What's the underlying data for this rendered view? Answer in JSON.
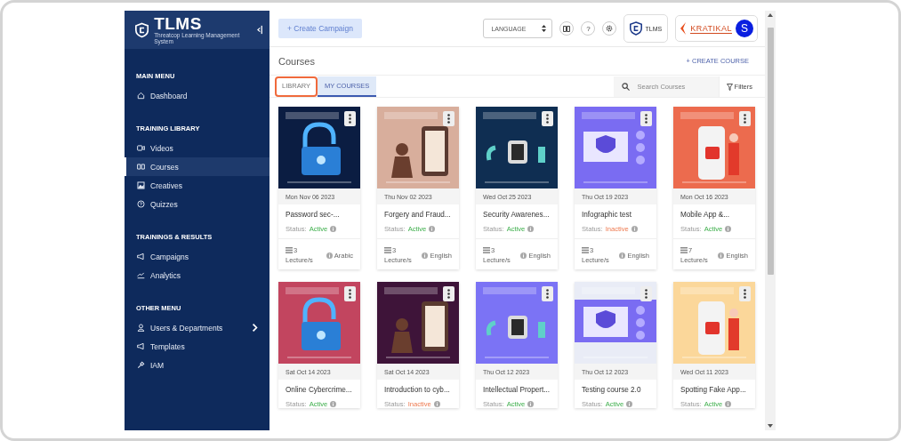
{
  "sidebar": {
    "logo_text": "TLMS",
    "logo_subtitle": "Threatcop Learning Management System",
    "sections": [
      {
        "title": "MAIN MENU",
        "items": [
          {
            "label": "Dashboard",
            "selected": false
          }
        ]
      },
      {
        "title": "TRAINING LIBRARY",
        "items": [
          {
            "label": "Videos",
            "selected": false
          },
          {
            "label": "Courses",
            "selected": true
          },
          {
            "label": "Creatives",
            "selected": false
          },
          {
            "label": "Quizzes",
            "selected": false
          }
        ]
      },
      {
        "title": "TRAININGS & RESULTS",
        "items": [
          {
            "label": "Campaigns",
            "selected": false
          },
          {
            "label": "Analytics",
            "selected": false
          }
        ]
      },
      {
        "title": "OTHER MENU",
        "items": [
          {
            "label": "Users & Departments",
            "selected": false,
            "submenu": true
          },
          {
            "label": "Templates",
            "selected": false
          },
          {
            "label": "IAM",
            "selected": false
          }
        ]
      }
    ]
  },
  "topbar": {
    "create_button": "+ Create Campaign",
    "language": "LANGUAGE",
    "help": "?",
    "brand": "TLMS",
    "partner": "KRATIKAL",
    "avatar": "S"
  },
  "page": {
    "title": "Courses",
    "create_link": "+ CREATE COURSE",
    "tabs": [
      {
        "label": "LIBRARY",
        "selected": false,
        "highlighted": true
      },
      {
        "label": "MY COURSES",
        "selected": true,
        "highlighted": false
      }
    ],
    "search": {
      "placeholder": "Search Courses"
    },
    "filters": "Filters"
  },
  "courses": [
    {
      "color": "#0b1d42",
      "date": "Mon Nov 06 2023",
      "title": "Password sec-...",
      "status_label": "Status:",
      "status": "Active",
      "active": true,
      "lecture_count": "3",
      "lecture_unit": "Lecture/s",
      "language": "Arabic"
    },
    {
      "color": "#d8ae9c",
      "date": "Thu Nov 02 2023",
      "title": "Forgery and Fraud...",
      "status_label": "Status:",
      "status": "Active",
      "active": true,
      "lecture_count": "3",
      "lecture_unit": "Lecture/s",
      "language": "English"
    },
    {
      "color": "#0f2e52",
      "date": "Wed Oct 25 2023",
      "title": "Security Awarenes...",
      "status_label": "Status:",
      "status": "Active",
      "active": true,
      "lecture_count": "3",
      "lecture_unit": "Lecture/s",
      "language": "English"
    },
    {
      "color": "#7a6cf2",
      "date": "Thu Oct 19 2023",
      "title": "Infographic test",
      "status_label": "Status:",
      "status": "Inactive",
      "active": false,
      "lecture_count": "3",
      "lecture_unit": "Lecture/s",
      "language": "English"
    },
    {
      "color": "#ec6b4e",
      "date": "Mon Oct 16 2023",
      "title": "Mobile App &...",
      "status_label": "Status:",
      "status": "Active",
      "active": true,
      "lecture_count": "7",
      "lecture_unit": "Lecture/s",
      "language": "English"
    },
    {
      "color": "#c2455f",
      "date": "Sat Oct 14 2023",
      "title": "Online Cybercrime...",
      "status_label": "Status:",
      "status": "Active",
      "active": true
    },
    {
      "color": "#3e1439",
      "date": "Sat Oct 14 2023",
      "title": "Introduction to cyb...",
      "status_label": "Status:",
      "status": "Inactive",
      "active": false
    },
    {
      "color": "#7b73f5",
      "date": "Thu Oct 12 2023",
      "title": "Intellectual Propert...",
      "status_label": "Status:",
      "status": "Active",
      "active": true
    },
    {
      "color": "#e9ecf6",
      "date": "Thu Oct 12 2023",
      "title": "Testing course 2.0",
      "status_label": "Status:",
      "status": "Active",
      "active": true
    },
    {
      "color": "#fbd79a",
      "date": "Wed Oct 11 2023",
      "title": "Spotting Fake App...",
      "status_label": "Status:",
      "status": "Active",
      "active": true
    }
  ]
}
